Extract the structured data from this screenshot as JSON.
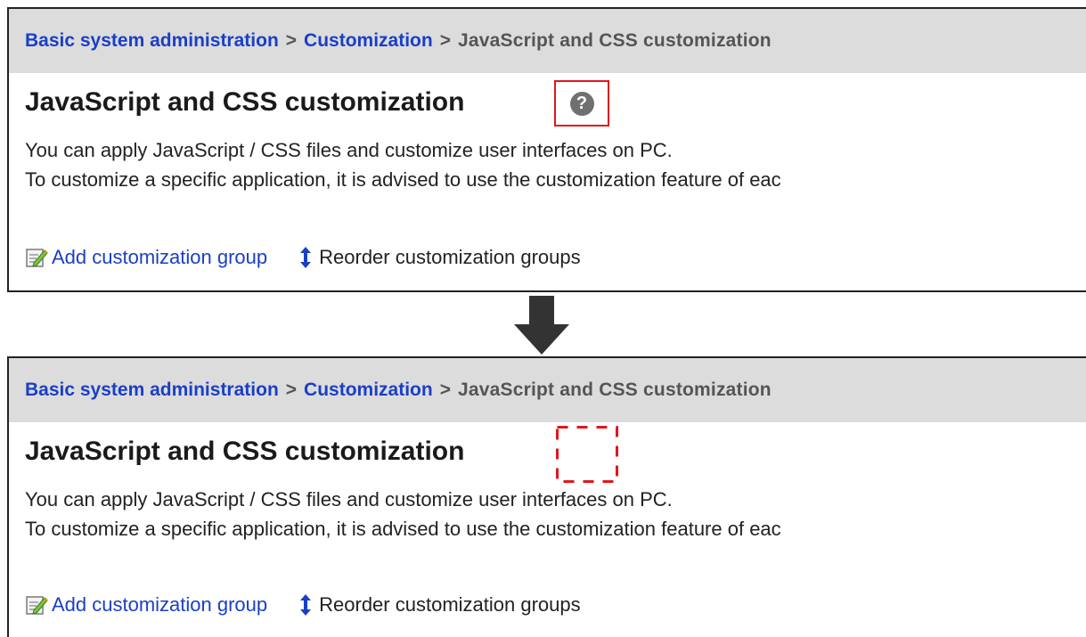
{
  "breadcrumb": {
    "item1": "Basic system administration",
    "item2": "Customization",
    "current": "JavaScript and CSS customization",
    "separator": ">"
  },
  "page": {
    "title": "JavaScript and CSS customization",
    "help_glyph": "?",
    "description_line1": "You can apply JavaScript / CSS files and customize user interfaces on PC.",
    "description_line2": "To customize a specific application, it is advised to use the customization feature of eac"
  },
  "actions": {
    "add_label": "Add customization group",
    "reorder_label": "Reorder customization groups"
  },
  "icons": {
    "help": "help-circle-icon",
    "add": "edit-note-icon",
    "reorder": "up-down-arrow-icon",
    "transition": "arrow-down-icon"
  },
  "colors": {
    "link": "#1a3fc7",
    "highlight": "#e0171d",
    "header_bg": "#dcdcdc",
    "help_icon": "#707070"
  }
}
